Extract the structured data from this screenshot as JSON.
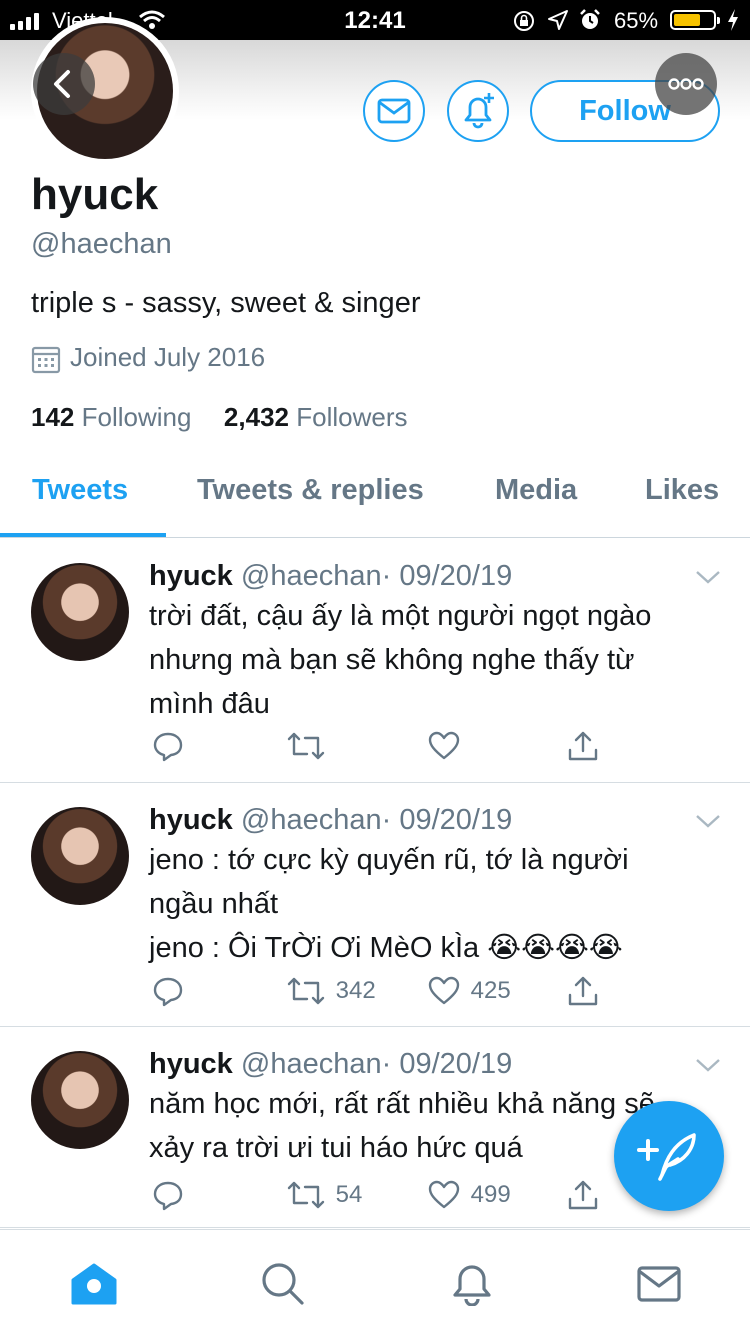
{
  "status_bar": {
    "carrier": "Viettel",
    "time": "12:41",
    "battery": "65%",
    "icons": [
      "signal-icon",
      "wifi-icon",
      "lock-rotation-icon",
      "location-icon",
      "alarm-icon",
      "battery-icon",
      "charging-icon"
    ]
  },
  "header": {
    "follow_label": "Follow",
    "icons": [
      "back-icon",
      "message-icon",
      "notification-add-icon",
      "more-icon"
    ]
  },
  "profile": {
    "name": "hyuck",
    "handle": "@haechan",
    "bio": "triple s - sassy, sweet & singer",
    "joined": "Joined July 2016",
    "following_count": "142",
    "following_label": "Following",
    "followers_count": "2,432",
    "followers_label": "Followers"
  },
  "tabs": [
    {
      "label": "Tweets",
      "active": true
    },
    {
      "label": "Tweets & replies",
      "active": false
    },
    {
      "label": "Media",
      "active": false
    },
    {
      "label": "Likes",
      "active": false
    }
  ],
  "tweets": [
    {
      "name": "hyuck",
      "handle": "@haechan",
      "date": "· 09/20/19",
      "lines": [
        "trời đất, cậu ấy là một người ngọt ngào",
        "nhưng mà bạn sẽ không nghe thấy từ",
        "mình đâu"
      ],
      "retweets": "",
      "likes": ""
    },
    {
      "name": "hyuck",
      "handle": "@haechan",
      "date": "· 09/20/19",
      "lines": [
        "jeno : tớ cực kỳ quyến rũ, tớ là người",
        "ngầu nhất",
        "jeno : Ôi TrỜi Ơi MèO kÌa 😭😭😭😭"
      ],
      "retweets": "342",
      "likes": "425"
    },
    {
      "name": "hyuck",
      "handle": "@haechan",
      "date": "· 09/20/19",
      "lines": [
        "năm học mới, rất rất nhiều khả năng sẽ",
        "xảy ra trời ưi tui háo hức quá"
      ],
      "retweets": "54",
      "likes": "499"
    }
  ],
  "bottom_nav": {
    "items": [
      "home-icon",
      "search-icon",
      "notifications-icon",
      "messages-icon"
    ]
  },
  "colors": {
    "accent": "#1da1f2",
    "secondary_text": "#657786",
    "primary_text": "#14171a"
  }
}
